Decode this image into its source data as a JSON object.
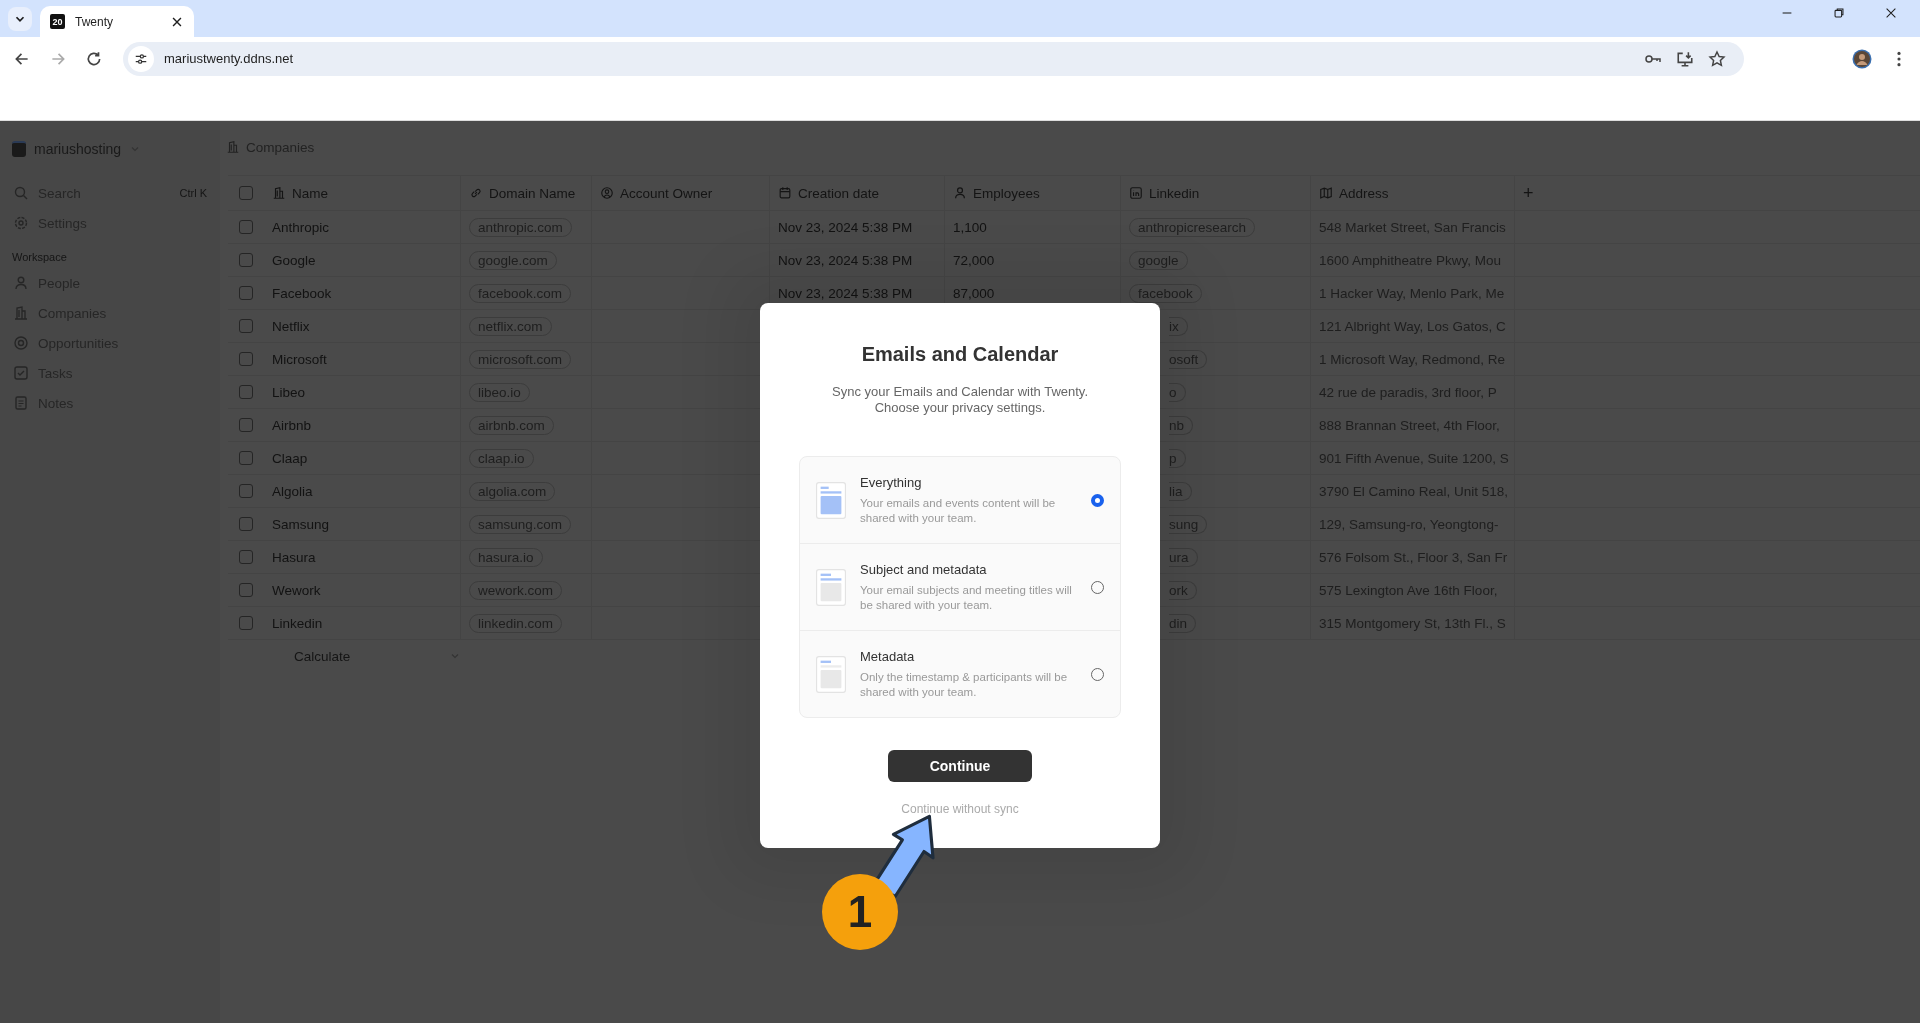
{
  "browser": {
    "tab_title": "Twenty",
    "favicon_text": "20",
    "url": "mariustwenty.ddns.net"
  },
  "sidebar": {
    "workspace": "mariushosting",
    "top_items": [
      {
        "label": "Search",
        "kind": "search",
        "hint": "Ctrl K"
      },
      {
        "label": "Settings",
        "kind": "settings"
      }
    ],
    "section_label": "Workspace",
    "nav_items": [
      {
        "label": "People",
        "kind": "people"
      },
      {
        "label": "Companies",
        "kind": "companies"
      },
      {
        "label": "Opportunities",
        "kind": "opportunities"
      },
      {
        "label": "Tasks",
        "kind": "tasks"
      },
      {
        "label": "Notes",
        "kind": "notes"
      }
    ]
  },
  "breadcrumb": "Companies",
  "table": {
    "columns": [
      {
        "label": "Name",
        "kind": "name"
      },
      {
        "label": "Domain Name",
        "kind": "link"
      },
      {
        "label": "Account Owner",
        "kind": "owner"
      },
      {
        "label": "Creation date",
        "kind": "date"
      },
      {
        "label": "Employees",
        "kind": "people"
      },
      {
        "label": "Linkedin",
        "kind": "linkedin"
      },
      {
        "label": "Address",
        "kind": "map"
      }
    ],
    "add_column": "+",
    "all_checked": false,
    "rows": [
      {
        "checked": false,
        "name": "Anthropic",
        "domain": "anthropic.com",
        "created": "Nov 23, 2024 5:38 PM",
        "employees": "1,100",
        "linkedin": {
          "text": "anthropicresearch",
          "cut": false
        },
        "address": "548 Market Street, San Francis"
      },
      {
        "checked": false,
        "name": "Google",
        "domain": "google.com",
        "created": "Nov 23, 2024 5:38 PM",
        "employees": "72,000",
        "linkedin": {
          "text": "google",
          "cut": false
        },
        "address": "1600 Amphitheatre Pkwy, Mou"
      },
      {
        "checked": false,
        "name": "Facebook",
        "domain": "facebook.com",
        "created": "Nov 23, 2024 5:38 PM",
        "employees": "87,000",
        "linkedin": {
          "text": "facebook",
          "cut": false
        },
        "address": "1 Hacker Way, Menlo Park, Me"
      },
      {
        "checked": false,
        "name": "Netflix",
        "domain": "netflix.com",
        "linkedin": {
          "text": "ix",
          "cut": true
        },
        "address": "121 Albright Way, Los Gatos, C"
      },
      {
        "checked": false,
        "name": "Microsoft",
        "domain": "microsoft.com",
        "linkedin": {
          "text": "osoft",
          "cut": true
        },
        "address": "1 Microsoft Way, Redmond, Re"
      },
      {
        "checked": false,
        "name": "Libeo",
        "domain": "libeo.io",
        "linkedin": {
          "text": "o",
          "cut": true
        },
        "address": "42 rue de paradis, 3rd floor, P"
      },
      {
        "checked": false,
        "name": "Airbnb",
        "domain": "airbnb.com",
        "linkedin": {
          "text": "nb",
          "cut": true
        },
        "address": "888 Brannan Street, 4th Floor,"
      },
      {
        "checked": false,
        "name": "Claap",
        "domain": "claap.io",
        "linkedin": {
          "text": "p",
          "cut": true
        },
        "address": "901 Fifth Avenue, Suite 1200, S"
      },
      {
        "checked": false,
        "name": "Algolia",
        "domain": "algolia.com",
        "linkedin": {
          "text": "lia",
          "cut": true
        },
        "address": "3790 El Camino Real, Unit 518,"
      },
      {
        "checked": false,
        "name": "Samsung",
        "domain": "samsung.com",
        "linkedin": {
          "text": "sung",
          "cut": true
        },
        "address": "129, Samsung-ro, Yeongtong-"
      },
      {
        "checked": false,
        "name": "Hasura",
        "domain": "hasura.io",
        "linkedin": {
          "text": "ura",
          "cut": true
        },
        "address": "576 Folsom St., Floor 3, San Fr"
      },
      {
        "checked": false,
        "name": "Wework",
        "domain": "wework.com",
        "linkedin": {
          "text": "ork",
          "cut": true
        },
        "address": "575 Lexington Ave 16th Floor,"
      },
      {
        "checked": false,
        "name": "Linkedin",
        "domain": "linkedin.com",
        "linkedin": {
          "text": "din",
          "cut": true
        },
        "address": "315 Montgomery St, 13th Fl., S"
      }
    ],
    "footer": "Calculate"
  },
  "modal": {
    "title": "Emails and Calendar",
    "subtitle": "Sync your Emails and Calendar with Twenty. Choose your privacy settings.",
    "options": [
      {
        "kind": "everything",
        "title": "Everything",
        "description": "Your emails and events content will be shared with your team.",
        "selected": true
      },
      {
        "kind": "subject",
        "title": "Subject and metadata",
        "description": "Your email subjects and meeting titles will be shared with your team.",
        "selected": false
      },
      {
        "kind": "metadata",
        "title": "Metadata",
        "description": "Only the timestamp & participants will be shared with your team.",
        "selected": false
      }
    ],
    "primary_button": "Continue",
    "link": "Continue without sync"
  },
  "annotation": {
    "step": "1"
  }
}
